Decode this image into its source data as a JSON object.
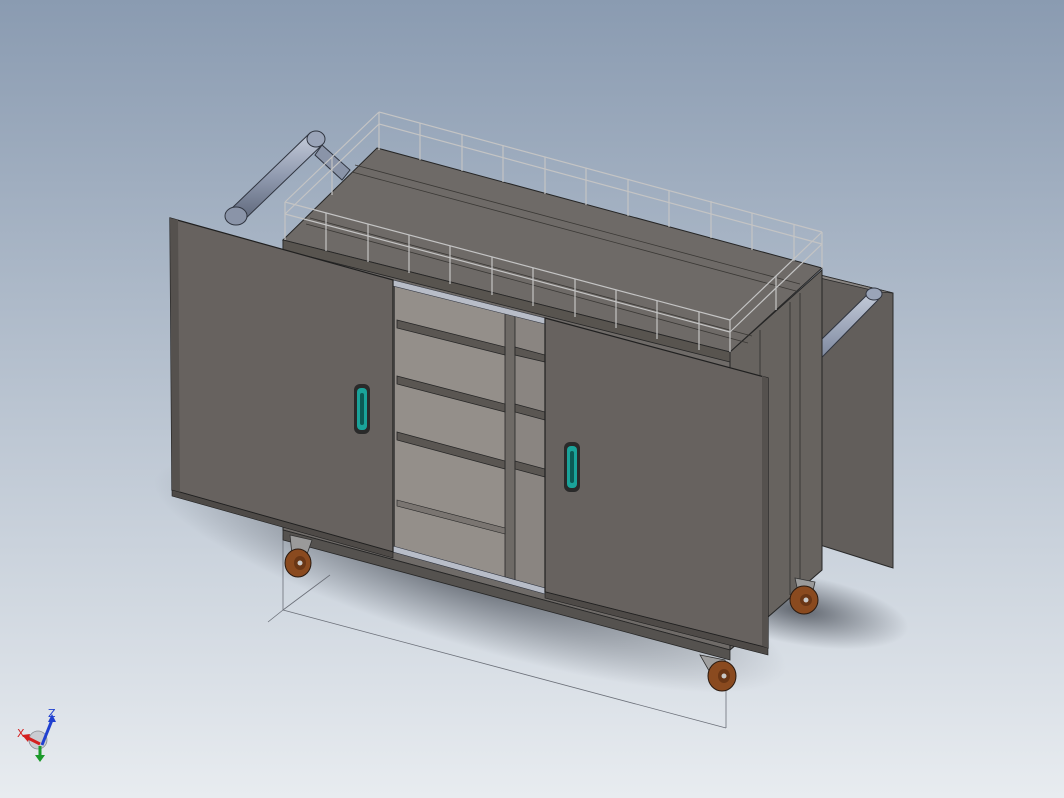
{
  "app": {
    "background_top": "#8a9bb1",
    "background_bottom": "#e8ecf0"
  },
  "model": {
    "body_color": "#6f6b68",
    "top_color": "#6e6a67",
    "door_color": "#67625f",
    "handle_accent": "#1aa39a",
    "railing_color": "#b0b0b0",
    "tube_color": "#9aa4b8",
    "wheel_color": "#8a4a1f"
  },
  "triad": {
    "x_label": "X",
    "y_label": "Y",
    "z_label": "Z",
    "x_color": "#d42020",
    "y_color": "#1a9a2a",
    "z_color": "#2040d0"
  }
}
